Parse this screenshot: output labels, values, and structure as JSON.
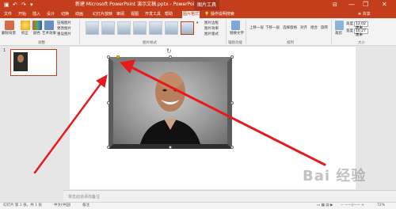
{
  "titlebar": {
    "title": "新建 Microsoft PowerPoint 演示文稿.pptx  -  PowerPoint",
    "context_tab": "图片工具",
    "user": "",
    "minimize": "—",
    "restore": "❐",
    "close": "✕"
  },
  "tabs": [
    "文件",
    "开始",
    "插入",
    "设计",
    "切换",
    "动画",
    "幻灯片放映",
    "审阅",
    "视图",
    "开发工具",
    "帮助",
    "图片格式"
  ],
  "tell_me": "操作说明搜索",
  "share": "共享",
  "ribbon": {
    "remove_bg": "删除背景",
    "corrections": "校正",
    "color": "颜色",
    "artistic": "艺术效果",
    "compress": "压缩图片",
    "change": "更改图片",
    "reset": "重设图片",
    "adjust_group": "调整",
    "styles_group": "图片样式",
    "border": "图片边框",
    "effects": "图片效果",
    "layout": "图片版式",
    "alt_text": "替换文字",
    "access_group": "辅助功能",
    "bring_forward": "上移一层",
    "send_backward": "下移一层",
    "selection_pane": "选择窗格",
    "align": "对齐",
    "group": "组合",
    "rotate": "旋转",
    "arrange_group": "排列",
    "crop": "裁剪",
    "height_label": "高度",
    "height_value": "12.02 厘米",
    "width_label": "宽度",
    "width_value": "16.27 厘米",
    "size_group": "大小"
  },
  "thumbnail": {
    "number": "1"
  },
  "notes_placeholder": "单击此处添加备注",
  "status": {
    "slide": "幻灯片 第 1 张，共 1 张",
    "lang": "中文(中国)",
    "notes": "备注",
    "zoom": "72%"
  },
  "watermark": "Bai 经验"
}
